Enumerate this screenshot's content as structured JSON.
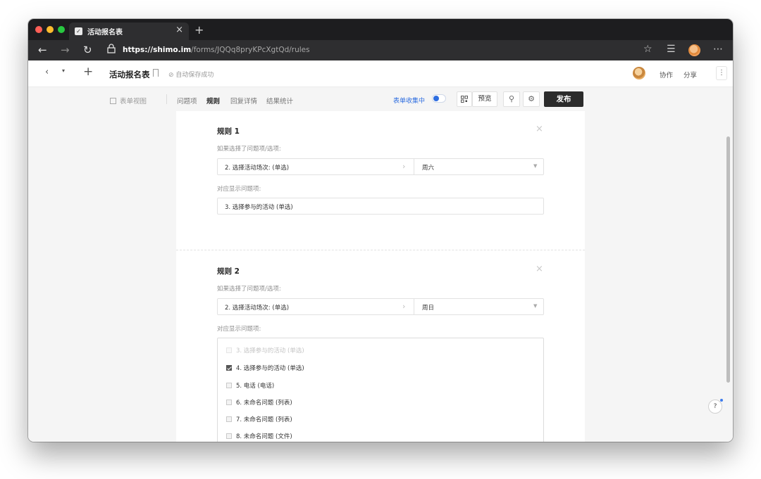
{
  "browser": {
    "tab_title": "活动报名表",
    "tab_close": "×",
    "new_tab": "+",
    "url_host": "https://shimo.im",
    "url_path": "/forms/JQQq8pryKPcXgtQd/rules",
    "more": "⋯"
  },
  "app": {
    "title": "活动报名表",
    "saved_status": "⊘ 自动保存成功",
    "collab": "协作",
    "share": "分享",
    "more": "⋮"
  },
  "toolbar": {
    "form_view": "表单视图",
    "tabs": [
      {
        "label": "问题项",
        "active": false
      },
      {
        "label": "规则",
        "active": true
      },
      {
        "label": "回复详情",
        "active": false
      },
      {
        "label": "结果统计",
        "active": false
      }
    ],
    "collecting": "表单收集中",
    "collecting_on": true,
    "preview": "预览",
    "publish": "发布"
  },
  "rules": [
    {
      "title": "规则 1",
      "if_label": "如果选择了问题项/选项:",
      "question": "2. 选择活动场次: (单选)",
      "option": "周六",
      "show_label": "对应显示问题项:",
      "show_value": "3. 选择参与的活动 (单选)"
    },
    {
      "title": "规则 2",
      "if_label": "如果选择了问题项/选项:",
      "question": "2. 选择活动场次: (单选)",
      "option": "周日",
      "show_label": "对应显示问题项:",
      "show_options": [
        {
          "label": "3. 选择参与的活动 (单选)",
          "checked": false,
          "disabled": true
        },
        {
          "label": "4. 选择参与的活动 (单选)",
          "checked": true,
          "disabled": false
        },
        {
          "label": "5. 电话 (电话)",
          "checked": false,
          "disabled": false
        },
        {
          "label": "6. 未命名问题 (列表)",
          "checked": false,
          "disabled": false
        },
        {
          "label": "7. 未命名问题 (列表)",
          "checked": false,
          "disabled": false
        },
        {
          "label": "8. 未命名问题 (文件)",
          "checked": false,
          "disabled": false
        }
      ]
    }
  ],
  "help": "?",
  "colors": {
    "accent": "#2f6ee0",
    "publish_bg": "#2b2b2b"
  }
}
